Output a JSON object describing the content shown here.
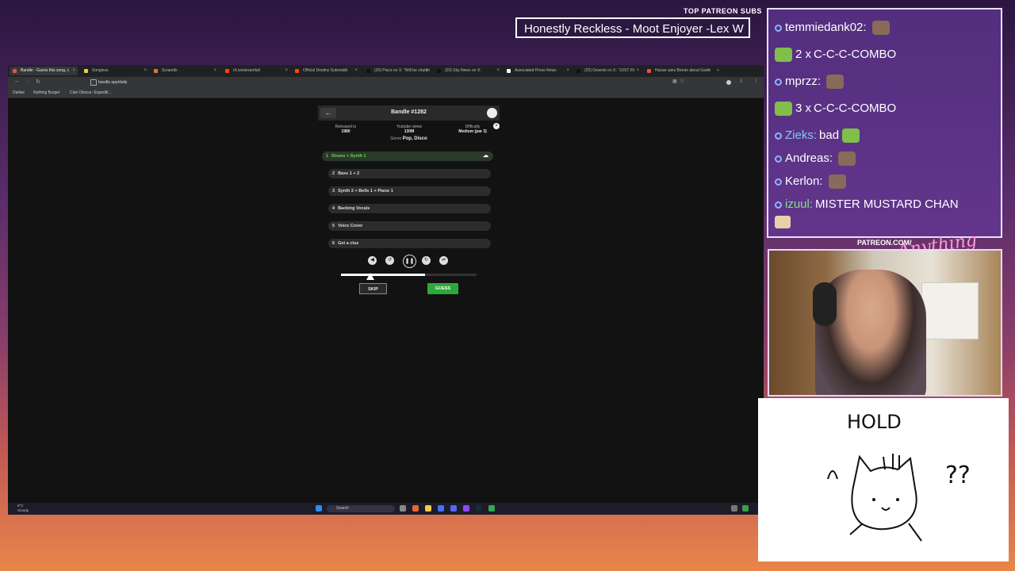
{
  "overlay": {
    "top_patreon_subs": "TOP PATREON SUBS",
    "banner_text": "Honestly Reckless - Moot Enjoyer -Lex W",
    "patreon_url": "PATREON.COM/",
    "logo_text": "Anything Else"
  },
  "browser": {
    "tabs": [
      {
        "label": "Bandle - Guess this song, c",
        "active": true,
        "color": "#e5533d"
      },
      {
        "label": "Songless",
        "active": false,
        "color": "#f2c94c"
      },
      {
        "label": "Scrandle",
        "active": false,
        "color": "#d97a3a"
      },
      {
        "label": "r/Livestreamfail",
        "active": false,
        "color": "#ff4500"
      },
      {
        "label": "Official Destiny Subreddit",
        "active": false,
        "color": "#ff4500"
      },
      {
        "label": "(20) Pisco on X: \"Will be chattin",
        "active": false,
        "color": "#111111"
      },
      {
        "label": "(20) Sky News on X: \"BREAKING",
        "active": false,
        "color": "#111111"
      },
      {
        "label": "Associated Press News",
        "active": false,
        "color": "#ffffff"
      },
      {
        "label": "(20) Dexerto on X: \"JUST IN",
        "active": false,
        "color": "#111111"
      },
      {
        "label": "Hasan asks Bernie about Gavin",
        "active": false,
        "color": "#e5533d"
      }
    ],
    "url": "bandle.app/daily",
    "bookmarks": [
      "Dailies",
      "Nothing Burger",
      "Clair Obscur: Expediti..."
    ]
  },
  "game": {
    "title": "Bandle #1282",
    "released_label": "Released in",
    "released_value": "1980",
    "views_label": "Youtube views",
    "views_value": "130M",
    "difficulty_label": "Difficulty",
    "difficulty_value": "Medium (par 3)",
    "genre_label": "Genre",
    "genre_value": "Pop, Disco",
    "tracks": [
      {
        "num": "1",
        "label": "Drums + Synth 1",
        "active": true
      },
      {
        "num": "2",
        "label": "Bass 1 + 2",
        "active": false
      },
      {
        "num": "3",
        "label": "Synth 2 + Bells 1 + Piano 1",
        "active": false
      },
      {
        "num": "4",
        "label": "Backing Vocals",
        "active": false
      },
      {
        "num": "5",
        "label": "Voice Cover",
        "active": false
      },
      {
        "num": "6",
        "label": "Get a clue",
        "active": false
      }
    ],
    "progress": 0.62,
    "skip_label": "SKIP",
    "guess_label": "GUESS",
    "accent_color": "#2fa83a"
  },
  "taskbar": {
    "weather_temp": "6°C",
    "weather_desc": "Cloudy",
    "search_placeholder": "Search"
  },
  "chat": [
    {
      "user": "temmiedank02:",
      "text": "",
      "user_color": "#ffffff",
      "badge": "dot"
    },
    {
      "user": "2 x",
      "text": "C-C-C-COMBO",
      "user_color": "#ffffff",
      "badge": "emote"
    },
    {
      "user": "mprzz:",
      "text": "",
      "user_color": "#ffffff",
      "badge": "dot"
    },
    {
      "user": "3 x",
      "text": "C-C-C-COMBO",
      "user_color": "#ffffff",
      "badge": "emote"
    },
    {
      "user": "Zieks:",
      "text": "bad",
      "user_color": "#7fc8ff",
      "badge": "dot"
    },
    {
      "user": "Andreas:",
      "text": "",
      "user_color": "#ffffff",
      "badge": "dot"
    },
    {
      "user": "Kerlon:",
      "text": "",
      "user_color": "#ffffff",
      "badge": "dot"
    },
    {
      "user": "izuul:",
      "text": "MISTER MUSTARD CHAN",
      "user_color": "#7fe08a",
      "badge": "dot"
    }
  ],
  "whiteboard": {
    "text": "HOLD",
    "question": "??"
  }
}
